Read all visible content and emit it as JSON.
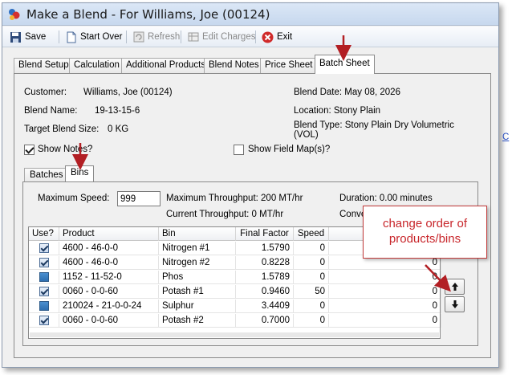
{
  "window": {
    "title": "Make a Blend - For Williams, Joe (00124)"
  },
  "toolbar": {
    "save": "Save",
    "start_over": "Start Over",
    "refresh": "Refresh",
    "edit_charges": "Edit Charges",
    "exit": "Exit"
  },
  "tabs": [
    "Blend Setup",
    "Calculation",
    "Additional Products",
    "Blend Notes",
    "Price Sheet",
    "Batch Sheet"
  ],
  "info": {
    "customer_label": "Customer:",
    "customer_value": "Williams, Joe (00124)",
    "blend_name_label": "Blend Name:",
    "blend_name_value": "19-13-15-6",
    "target_size_label": "Target Blend Size:",
    "target_size_value": "0 KG",
    "blend_date": "Blend Date: May 08, 2026",
    "location": "Location: Stony Plain",
    "blend_type": "Blend Type: Stony Plain Dry Volumetric (VOL)",
    "show_notes": "Show Notes?",
    "show_field_map": "Show Field Map(s)?"
  },
  "inner_tabs": [
    "Batches",
    "Bins"
  ],
  "bins": {
    "max_speed_label": "Maximum Speed:",
    "max_speed_value": "999",
    "max_throughput": "Maximum Throughput: 200 MT/hr",
    "current_throughput": "Current Throughput: 0 MT/hr",
    "duration": "Duration: 0.00 minutes",
    "conv_partial": "Conve"
  },
  "grid": {
    "columns": [
      "Use?",
      "Product",
      "Bin",
      "Final Factor",
      "Speed"
    ],
    "rows": [
      {
        "use": "checked",
        "product": "4600 - 46-0-0",
        "bin": "Nitrogen #1",
        "factor": "1.5790",
        "speed": "0",
        "last": ""
      },
      {
        "use": "checked",
        "product": "4600 - 46-0-0",
        "bin": "Nitrogen #2",
        "factor": "0.8228",
        "speed": "0",
        "last": "0"
      },
      {
        "use": "filled",
        "product": "1152 - 11-52-0",
        "bin": "Phos",
        "factor": "1.5789",
        "speed": "0",
        "last": "0"
      },
      {
        "use": "checked",
        "product": "0060 - 0-0-60",
        "bin": "Potash #1",
        "factor": "0.9460",
        "speed": "50",
        "last": "0"
      },
      {
        "use": "filled",
        "product": "210024 - 21-0-0-24",
        "bin": "Sulphur",
        "factor": "3.4409",
        "speed": "0",
        "last": "0"
      },
      {
        "use": "checked",
        "product": "0060 - 0-0-60",
        "bin": "Potash #2",
        "factor": "0.7000",
        "speed": "0",
        "last": "0"
      }
    ]
  },
  "callout": {
    "text": "change order of products/bins"
  },
  "side_link": "C",
  "colors": {
    "annotation_red": "#c8262b",
    "titlebar": "#c7d8ee"
  }
}
